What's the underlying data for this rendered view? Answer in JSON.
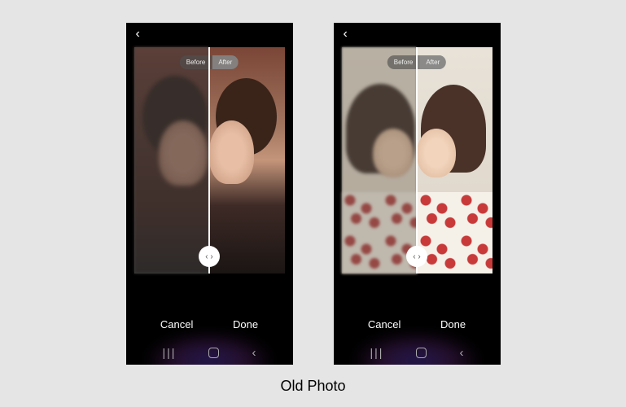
{
  "caption": "Old Photo",
  "phones": [
    {
      "compare": {
        "before": "Before",
        "after": "After"
      },
      "actions": {
        "cancel": "Cancel",
        "done": "Done"
      }
    },
    {
      "compare": {
        "before": "Before",
        "after": "After"
      },
      "actions": {
        "cancel": "Cancel",
        "done": "Done"
      }
    }
  ],
  "slider_glyph": "‹ ›",
  "nav_recents_glyph": "|||"
}
